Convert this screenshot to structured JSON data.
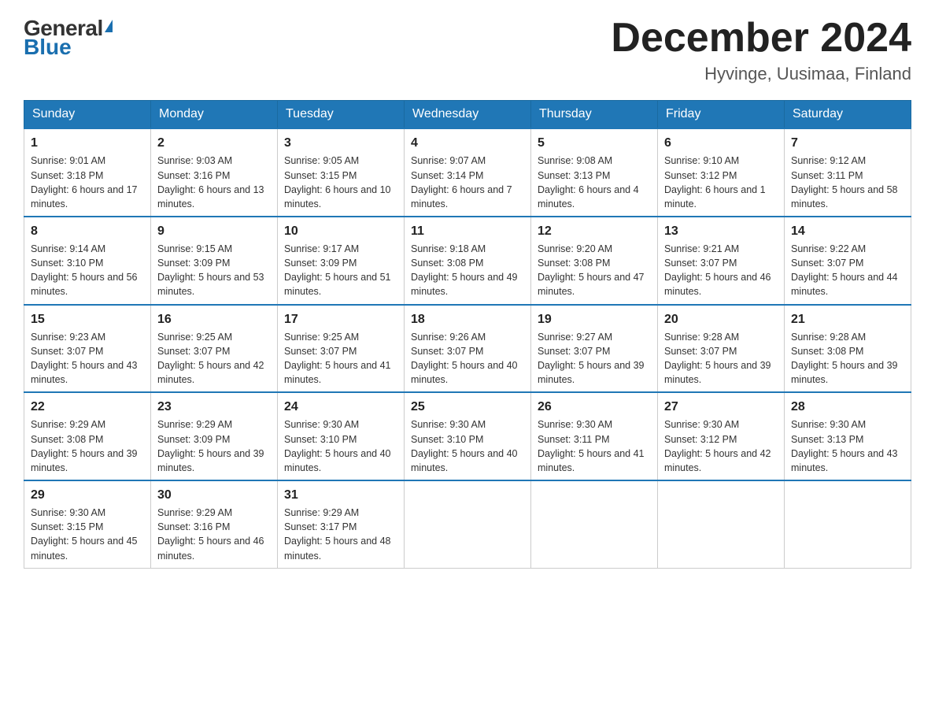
{
  "header": {
    "logo_general": "General",
    "logo_blue": "Blue",
    "month_year": "December 2024",
    "location": "Hyvinge, Uusimaa, Finland"
  },
  "days_of_week": [
    "Sunday",
    "Monday",
    "Tuesday",
    "Wednesday",
    "Thursday",
    "Friday",
    "Saturday"
  ],
  "weeks": [
    [
      {
        "day": "1",
        "sunrise": "9:01 AM",
        "sunset": "3:18 PM",
        "daylight": "6 hours and 17 minutes."
      },
      {
        "day": "2",
        "sunrise": "9:03 AM",
        "sunset": "3:16 PM",
        "daylight": "6 hours and 13 minutes."
      },
      {
        "day": "3",
        "sunrise": "9:05 AM",
        "sunset": "3:15 PM",
        "daylight": "6 hours and 10 minutes."
      },
      {
        "day": "4",
        "sunrise": "9:07 AM",
        "sunset": "3:14 PM",
        "daylight": "6 hours and 7 minutes."
      },
      {
        "day": "5",
        "sunrise": "9:08 AM",
        "sunset": "3:13 PM",
        "daylight": "6 hours and 4 minutes."
      },
      {
        "day": "6",
        "sunrise": "9:10 AM",
        "sunset": "3:12 PM",
        "daylight": "6 hours and 1 minute."
      },
      {
        "day": "7",
        "sunrise": "9:12 AM",
        "sunset": "3:11 PM",
        "daylight": "5 hours and 58 minutes."
      }
    ],
    [
      {
        "day": "8",
        "sunrise": "9:14 AM",
        "sunset": "3:10 PM",
        "daylight": "5 hours and 56 minutes."
      },
      {
        "day": "9",
        "sunrise": "9:15 AM",
        "sunset": "3:09 PM",
        "daylight": "5 hours and 53 minutes."
      },
      {
        "day": "10",
        "sunrise": "9:17 AM",
        "sunset": "3:09 PM",
        "daylight": "5 hours and 51 minutes."
      },
      {
        "day": "11",
        "sunrise": "9:18 AM",
        "sunset": "3:08 PM",
        "daylight": "5 hours and 49 minutes."
      },
      {
        "day": "12",
        "sunrise": "9:20 AM",
        "sunset": "3:08 PM",
        "daylight": "5 hours and 47 minutes."
      },
      {
        "day": "13",
        "sunrise": "9:21 AM",
        "sunset": "3:07 PM",
        "daylight": "5 hours and 46 minutes."
      },
      {
        "day": "14",
        "sunrise": "9:22 AM",
        "sunset": "3:07 PM",
        "daylight": "5 hours and 44 minutes."
      }
    ],
    [
      {
        "day": "15",
        "sunrise": "9:23 AM",
        "sunset": "3:07 PM",
        "daylight": "5 hours and 43 minutes."
      },
      {
        "day": "16",
        "sunrise": "9:25 AM",
        "sunset": "3:07 PM",
        "daylight": "5 hours and 42 minutes."
      },
      {
        "day": "17",
        "sunrise": "9:25 AM",
        "sunset": "3:07 PM",
        "daylight": "5 hours and 41 minutes."
      },
      {
        "day": "18",
        "sunrise": "9:26 AM",
        "sunset": "3:07 PM",
        "daylight": "5 hours and 40 minutes."
      },
      {
        "day": "19",
        "sunrise": "9:27 AM",
        "sunset": "3:07 PM",
        "daylight": "5 hours and 39 minutes."
      },
      {
        "day": "20",
        "sunrise": "9:28 AM",
        "sunset": "3:07 PM",
        "daylight": "5 hours and 39 minutes."
      },
      {
        "day": "21",
        "sunrise": "9:28 AM",
        "sunset": "3:08 PM",
        "daylight": "5 hours and 39 minutes."
      }
    ],
    [
      {
        "day": "22",
        "sunrise": "9:29 AM",
        "sunset": "3:08 PM",
        "daylight": "5 hours and 39 minutes."
      },
      {
        "day": "23",
        "sunrise": "9:29 AM",
        "sunset": "3:09 PM",
        "daylight": "5 hours and 39 minutes."
      },
      {
        "day": "24",
        "sunrise": "9:30 AM",
        "sunset": "3:10 PM",
        "daylight": "5 hours and 40 minutes."
      },
      {
        "day": "25",
        "sunrise": "9:30 AM",
        "sunset": "3:10 PM",
        "daylight": "5 hours and 40 minutes."
      },
      {
        "day": "26",
        "sunrise": "9:30 AM",
        "sunset": "3:11 PM",
        "daylight": "5 hours and 41 minutes."
      },
      {
        "day": "27",
        "sunrise": "9:30 AM",
        "sunset": "3:12 PM",
        "daylight": "5 hours and 42 minutes."
      },
      {
        "day": "28",
        "sunrise": "9:30 AM",
        "sunset": "3:13 PM",
        "daylight": "5 hours and 43 minutes."
      }
    ],
    [
      {
        "day": "29",
        "sunrise": "9:30 AM",
        "sunset": "3:15 PM",
        "daylight": "5 hours and 45 minutes."
      },
      {
        "day": "30",
        "sunrise": "9:29 AM",
        "sunset": "3:16 PM",
        "daylight": "5 hours and 46 minutes."
      },
      {
        "day": "31",
        "sunrise": "9:29 AM",
        "sunset": "3:17 PM",
        "daylight": "5 hours and 48 minutes."
      },
      null,
      null,
      null,
      null
    ]
  ]
}
